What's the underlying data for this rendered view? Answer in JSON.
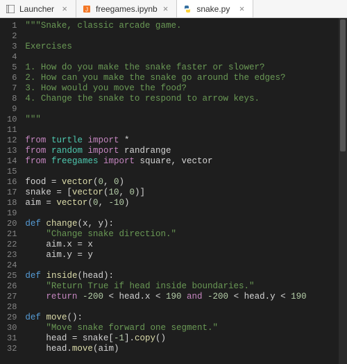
{
  "tabs": [
    {
      "label": "Launcher",
      "icon": "launcher",
      "active": false
    },
    {
      "label": "freegames.ipynb",
      "icon": "notebook",
      "active": false
    },
    {
      "label": "snake.py",
      "icon": "python",
      "active": true
    }
  ],
  "lines": [
    "\"\"\"Snake, classic arcade game.",
    "",
    "Exercises",
    "",
    "1. How do you make the snake faster or slower?",
    "2. How can you make the snake go around the edges?",
    "3. How would you move the food?",
    "4. Change the snake to respond to arrow keys.",
    "",
    "\"\"\"",
    "",
    "from turtle import *",
    "from random import randrange",
    "from freegames import square, vector",
    "",
    "food = vector(0, 0)",
    "snake = [vector(10, 0)]",
    "aim = vector(0, -10)",
    "",
    "def change(x, y):",
    "    \"Change snake direction.\"",
    "    aim.x = x",
    "    aim.y = y",
    "",
    "def inside(head):",
    "    \"Return True if head inside boundaries.\"",
    "    return -200 < head.x < 190 and -200 < head.y < 190",
    "",
    "def move():",
    "    \"Move snake forward one segment.\"",
    "    head = snake[-1].copy()",
    "    head.move(aim)"
  ],
  "start_line": 1
}
